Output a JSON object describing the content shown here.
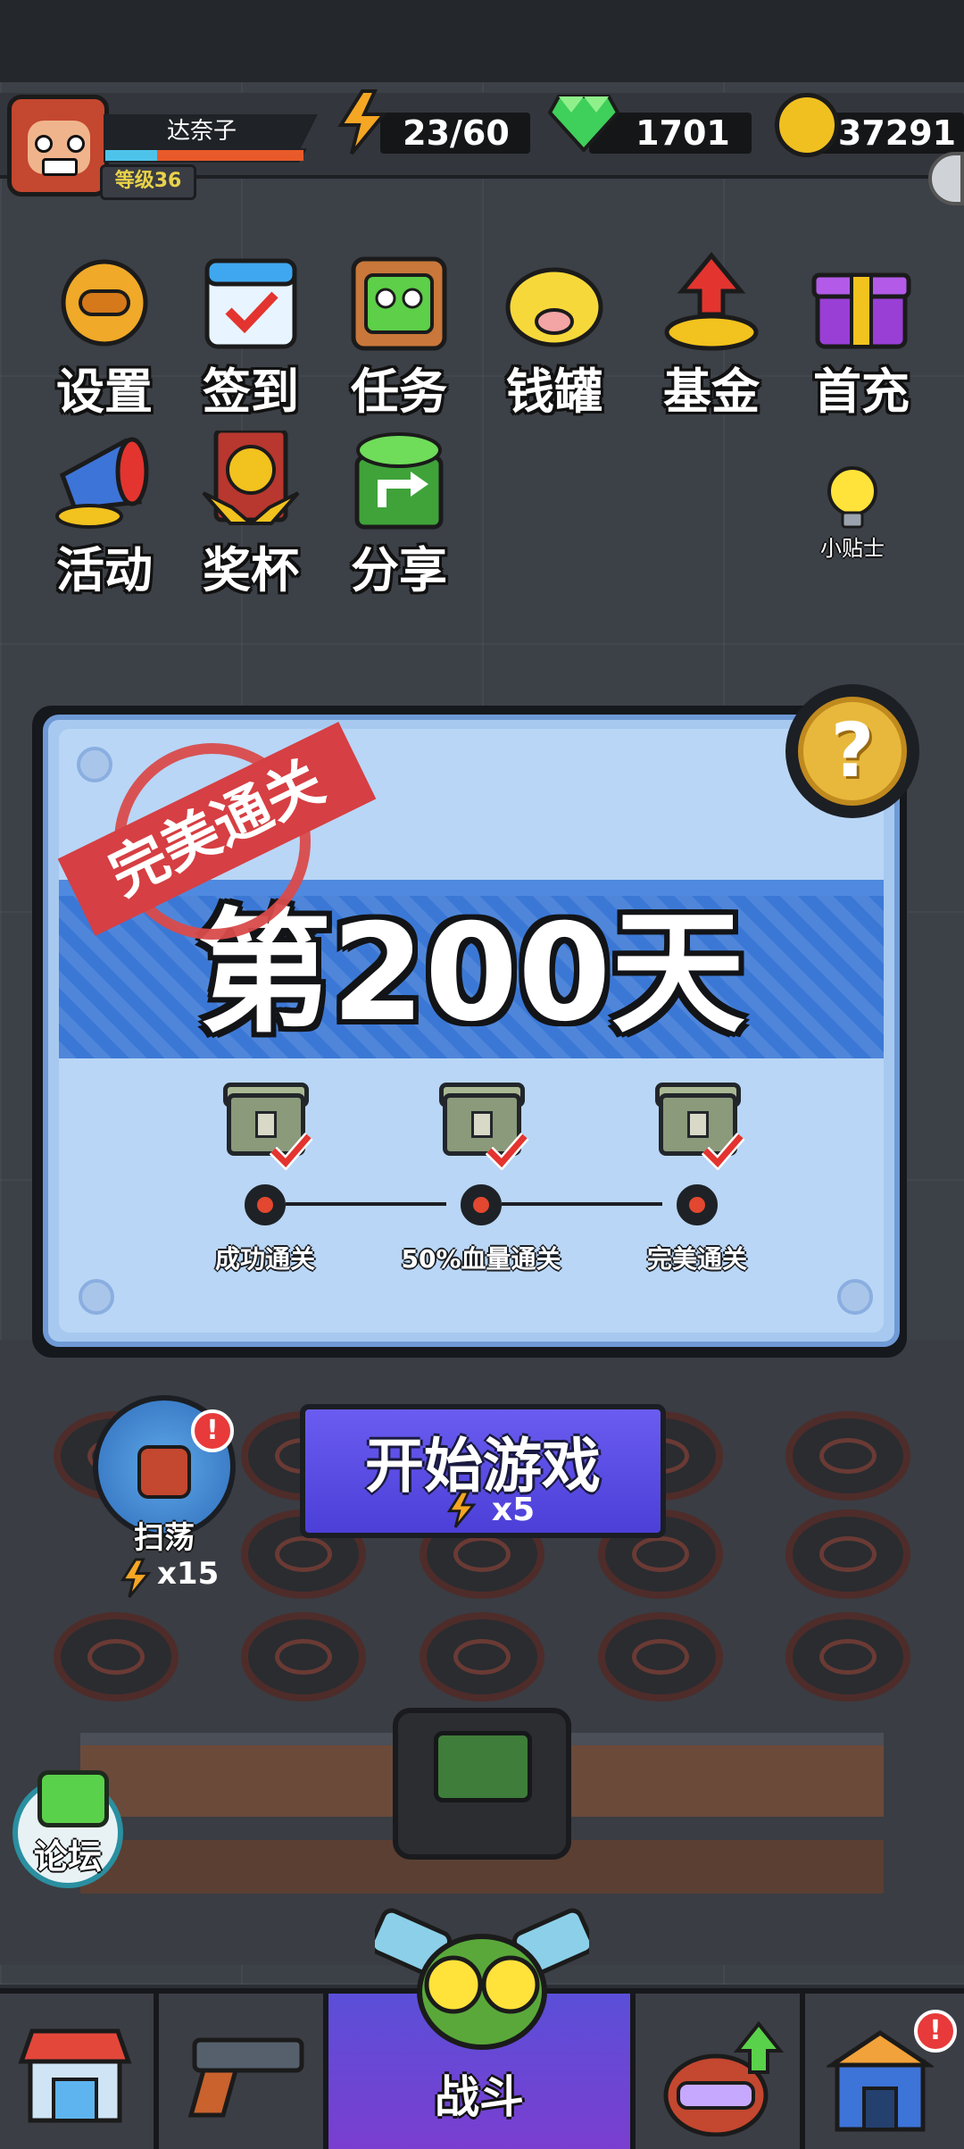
{
  "player": {
    "name": "达奈子",
    "level_label": "等级36",
    "energy": "23/60",
    "gems": "1701",
    "coins": "37291"
  },
  "menu_row1": [
    {
      "label": "设置",
      "icon": "gear-icon"
    },
    {
      "label": "签到",
      "icon": "calendar-check-icon"
    },
    {
      "label": "任务",
      "icon": "task-board-icon"
    },
    {
      "label": "钱罐",
      "icon": "piggy-bank-icon"
    },
    {
      "label": "基金",
      "icon": "fund-coins-icon"
    },
    {
      "label": "首充",
      "icon": "gift-box-icon"
    }
  ],
  "menu_row2": [
    {
      "label": "活动",
      "icon": "event-megaphone-icon"
    },
    {
      "label": "奖杯",
      "icon": "trophy-icon"
    },
    {
      "label": "分享",
      "icon": "share-icon"
    }
  ],
  "tip": {
    "label": "小贴士",
    "icon": "lightbulb-icon"
  },
  "stage": {
    "stamp": "完美通关",
    "title": "第200天",
    "help_symbol": "?",
    "objectives": [
      {
        "label": "成功通关",
        "completed": true
      },
      {
        "label": "50%血量通关",
        "completed": true
      },
      {
        "label": "完美通关",
        "completed": true
      }
    ]
  },
  "start_game": {
    "label": "开始游戏",
    "cost": "x5"
  },
  "sweep": {
    "label": "扫荡",
    "cost": "x15",
    "alert": "!"
  },
  "forum": {
    "label": "论坛"
  },
  "bottom_nav": [
    {
      "label": "",
      "icon": "shop-icon"
    },
    {
      "label": "",
      "icon": "pistol-icon"
    },
    {
      "label": "战斗",
      "icon": "battle-zombie-icon"
    },
    {
      "label": "",
      "icon": "hero-upgrade-icon"
    },
    {
      "label": "",
      "icon": "castle-icon",
      "alert": "!"
    }
  ],
  "colors": {
    "panel": "#b9d6f6",
    "band": "#3b78d6",
    "start_button": "#5a4ce4",
    "stamp_red": "#d63f43",
    "gem_green": "#3fcf5b",
    "coin_gold": "#f0c020"
  }
}
